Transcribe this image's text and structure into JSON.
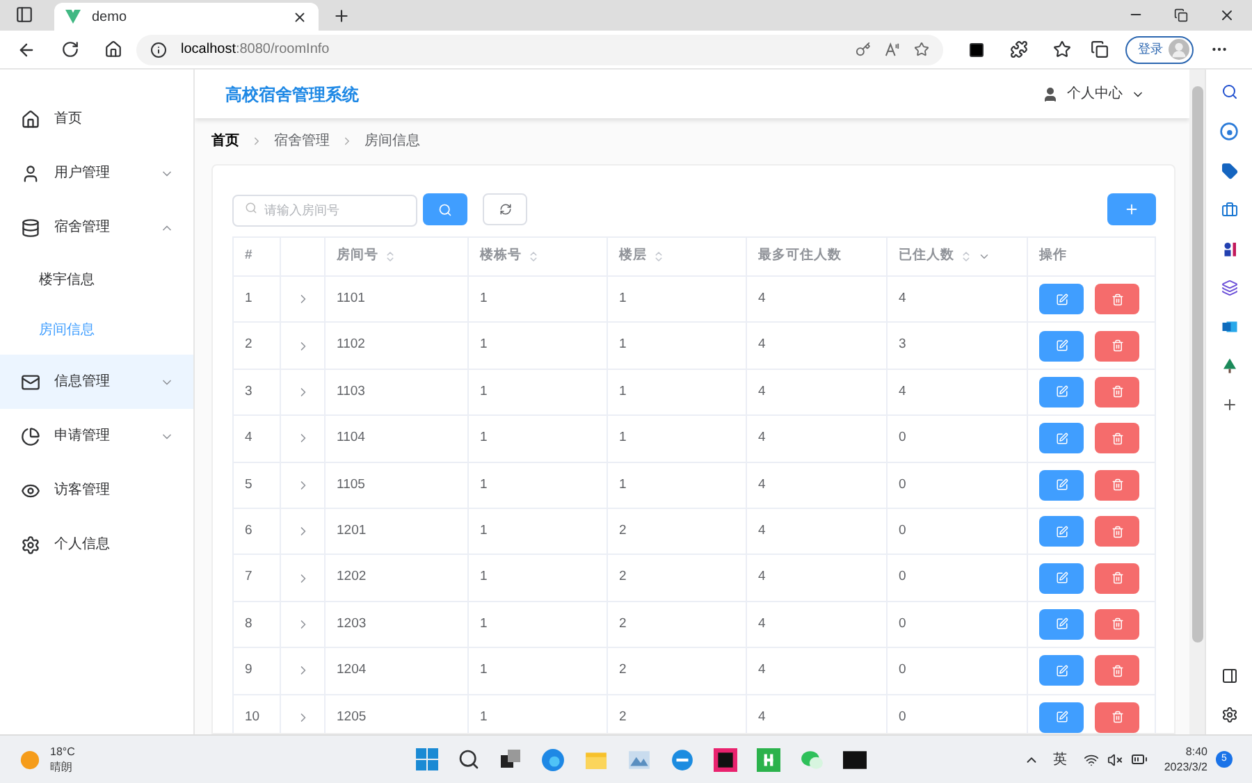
{
  "browser": {
    "tab": {
      "title": "demo"
    },
    "address": {
      "host": "localhost",
      "rest": ":8080/roomInfo"
    },
    "login_button": "登录"
  },
  "app": {
    "title": "高校宿舍管理系统",
    "user_menu": "个人中心"
  },
  "sidebar": {
    "items": [
      {
        "label": "首页",
        "kind": "link",
        "highlighted": false
      },
      {
        "label": "用户管理",
        "kind": "submenu",
        "expanded": false,
        "highlighted": false
      },
      {
        "label": "宿舍管理",
        "kind": "submenu",
        "expanded": true,
        "highlighted": false,
        "children": [
          {
            "label": "楼宇信息",
            "selected": false
          },
          {
            "label": "房间信息",
            "selected": true
          }
        ]
      },
      {
        "label": "信息管理",
        "kind": "submenu",
        "expanded": false,
        "highlighted": true
      },
      {
        "label": "申请管理",
        "kind": "submenu",
        "expanded": false,
        "highlighted": false
      },
      {
        "label": "访客管理",
        "kind": "link",
        "highlighted": false
      },
      {
        "label": "个人信息",
        "kind": "link",
        "highlighted": false
      }
    ]
  },
  "breadcrumb": [
    "首页",
    "宿舍管理",
    "房间信息"
  ],
  "search": {
    "placeholder": "请输入房间号"
  },
  "table": {
    "columns": [
      {
        "label": "#",
        "sortable": false,
        "filter": false
      },
      {
        "sortable": false,
        "filter": false
      },
      {
        "label": "房间号",
        "sortable": true,
        "filter": false
      },
      {
        "label": "楼栋号",
        "sortable": true,
        "filter": false
      },
      {
        "label": "楼层",
        "sortable": true,
        "filter": false
      },
      {
        "label": "最多可住人数",
        "sortable": false,
        "filter": false
      },
      {
        "label": "已住人数",
        "sortable": true,
        "filter": true
      },
      {
        "label": "操作",
        "sortable": false,
        "filter": false
      }
    ],
    "rows": [
      [
        "1",
        "",
        "1101",
        "1",
        "1",
        "4",
        "4"
      ],
      [
        "2",
        "",
        "1102",
        "1",
        "1",
        "4",
        "3"
      ],
      [
        "3",
        "",
        "1103",
        "1",
        "1",
        "4",
        "4"
      ],
      [
        "4",
        "",
        "1104",
        "1",
        "1",
        "4",
        "0"
      ],
      [
        "5",
        "",
        "1105",
        "1",
        "1",
        "4",
        "0"
      ],
      [
        "6",
        "",
        "1201",
        "1",
        "2",
        "4",
        "0"
      ],
      [
        "7",
        "",
        "1202",
        "1",
        "2",
        "4",
        "0"
      ],
      [
        "8",
        "",
        "1203",
        "1",
        "2",
        "4",
        "0"
      ],
      [
        "9",
        "",
        "1204",
        "1",
        "2",
        "4",
        "0"
      ],
      [
        "10",
        "",
        "1205",
        "1",
        "2",
        "4",
        "0"
      ]
    ]
  },
  "taskbar": {
    "temperature": "18°C",
    "weather": "晴朗",
    "ime": "英",
    "time": "8:40",
    "date": "2023/3/2",
    "notifications": "5"
  }
}
